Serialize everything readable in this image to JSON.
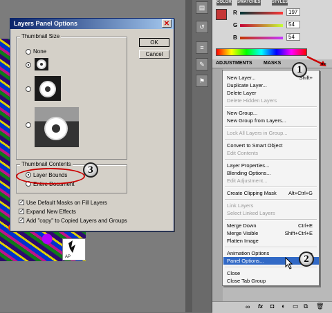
{
  "dialog": {
    "title": "Layers Panel Options",
    "thumbnail_size_label": "Thumbnail Size",
    "none_label": "None",
    "ok_label": "OK",
    "cancel_label": "Cancel",
    "thumbnail_contents_label": "Thumbnail Contents",
    "layer_bounds_label": "Layer Bounds",
    "entire_document_label": "Entire Document",
    "options": [
      "Use Default Masks on Fill Layers",
      "Expand New Effects",
      "Add \"copy\" to Copied Layers and Groups"
    ]
  },
  "color_panel": {
    "tabs": [
      "COLOR",
      "SWATCHES",
      "STYLES"
    ],
    "r_label": "R",
    "r_value": "197",
    "g_label": "G",
    "g_value": "54",
    "b_label": "B",
    "b_value": "54",
    "swatch_color": "#c53636"
  },
  "panel_tabs": {
    "adjustments": "ADJUSTMENTS",
    "masks": "MASKS"
  },
  "menu": {
    "items": [
      {
        "label": "New Layer...",
        "shortcut": "Shift+",
        "disabled": false
      },
      {
        "label": "Duplicate Layer...",
        "shortcut": "",
        "disabled": false
      },
      {
        "label": "Delete Layer",
        "shortcut": "",
        "disabled": false
      },
      {
        "label": "Delete Hidden Layers",
        "shortcut": "",
        "disabled": true
      },
      {
        "label": "New Group...",
        "shortcut": "",
        "disabled": false
      },
      {
        "label": "New Group from Layers...",
        "shortcut": "",
        "disabled": false
      },
      {
        "label": "Lock All Layers in Group...",
        "shortcut": "",
        "disabled": true
      },
      {
        "label": "Convert to Smart Object",
        "shortcut": "",
        "disabled": false
      },
      {
        "label": "Edit Contents",
        "shortcut": "",
        "disabled": true
      },
      {
        "label": "Layer Properties...",
        "shortcut": "",
        "disabled": false
      },
      {
        "label": "Blending Options...",
        "shortcut": "",
        "disabled": false
      },
      {
        "label": "Edit Adjustment...",
        "shortcut": "",
        "disabled": true
      },
      {
        "label": "Create Clipping Mask",
        "shortcut": "Alt+Ctrl+G",
        "disabled": false
      },
      {
        "label": "Link Layers",
        "shortcut": "",
        "disabled": true
      },
      {
        "label": "Select Linked Layers",
        "shortcut": "",
        "disabled": true
      },
      {
        "label": "Merge Down",
        "shortcut": "Ctrl+E",
        "disabled": false
      },
      {
        "label": "Merge Visible",
        "shortcut": "Shift+Ctrl+E",
        "disabled": false
      },
      {
        "label": "Flatten Image",
        "shortcut": "",
        "disabled": false
      },
      {
        "label": "Animation Options",
        "shortcut": "",
        "disabled": false
      },
      {
        "label": "Panel Options...",
        "shortcut": "",
        "disabled": false,
        "highlighted": true
      },
      {
        "label": "Close",
        "shortcut": "",
        "disabled": false
      },
      {
        "label": "Close Tab Group",
        "shortcut": "",
        "disabled": false
      }
    ]
  },
  "callouts": {
    "one": "1",
    "two": "2",
    "three": "3"
  },
  "accent_colors": {
    "callout_outline": "#cc0000",
    "highlight": "#3169c6",
    "titlebar": "#0a246a"
  }
}
